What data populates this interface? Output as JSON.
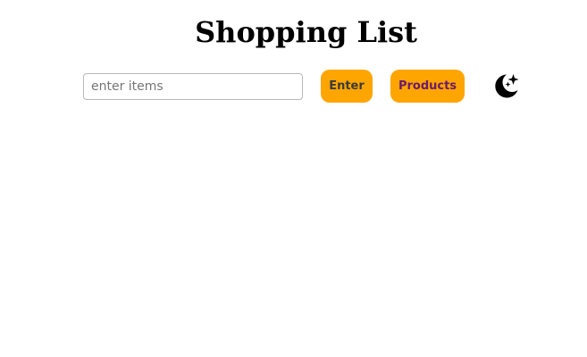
{
  "header": {
    "title": "Shopping List"
  },
  "controls": {
    "item_input": {
      "value": "",
      "placeholder": "enter items"
    },
    "enter_label": "Enter",
    "products_label": "Products",
    "theme_toggle_icon": "moon-stars-icon"
  },
  "colors": {
    "button_bg": "#ffa500",
    "enter_text": "#3a3a3a",
    "products_text": "#6b1a6b",
    "title_text": "#000000"
  }
}
